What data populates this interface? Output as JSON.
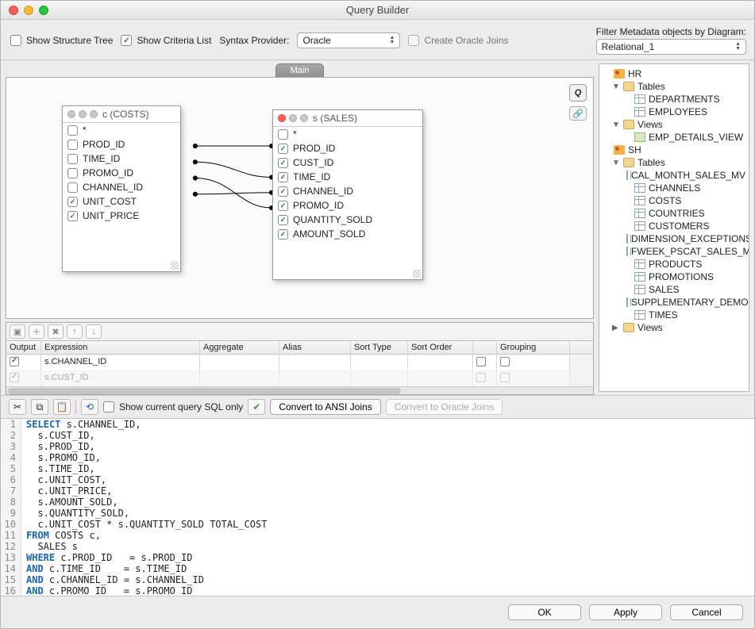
{
  "title": "Query Builder",
  "toolbar": {
    "show_structure_tree": {
      "label": "Show Structure Tree",
      "checked": false
    },
    "show_criteria_list": {
      "label": "Show Criteria List",
      "checked": true
    },
    "syntax_provider_label": "Syntax Provider:",
    "syntax_provider_value": "Oracle",
    "create_oracle_joins": {
      "label": "Create Oracle Joins",
      "checked": false
    },
    "filter_label": "Filter Metadata objects by Diagram:",
    "filter_value": "Relational_1"
  },
  "tabs": {
    "main": "Main"
  },
  "q_badge": "Q",
  "link_badge": "🔗",
  "nodes": {
    "c": {
      "title": "c (COSTS)",
      "fields": [
        {
          "name": "*",
          "checked": false
        },
        {
          "name": "PROD_ID",
          "checked": false
        },
        {
          "name": "TIME_ID",
          "checked": false
        },
        {
          "name": "PROMO_ID",
          "checked": false
        },
        {
          "name": "CHANNEL_ID",
          "checked": false
        },
        {
          "name": "UNIT_COST",
          "checked": true
        },
        {
          "name": "UNIT_PRICE",
          "checked": true
        }
      ]
    },
    "s": {
      "title": "s (SALES)",
      "fields": [
        {
          "name": "*",
          "checked": false
        },
        {
          "name": "PROD_ID",
          "checked": true
        },
        {
          "name": "CUST_ID",
          "checked": true
        },
        {
          "name": "TIME_ID",
          "checked": true
        },
        {
          "name": "CHANNEL_ID",
          "checked": true
        },
        {
          "name": "PROMO_ID",
          "checked": true
        },
        {
          "name": "QUANTITY_SOLD",
          "checked": true
        },
        {
          "name": "AMOUNT_SOLD",
          "checked": true
        }
      ]
    }
  },
  "criteria": {
    "headers": [
      "Output",
      "Expression",
      "Aggregate",
      "Alias",
      "Sort Type",
      "Sort Order",
      "",
      "Grouping"
    ],
    "rows": [
      {
        "output": true,
        "expression": "s.CHANNEL_ID",
        "group": false
      },
      {
        "output": true,
        "expression": "s.CUST_ID",
        "group": false
      }
    ]
  },
  "sql_toolbar": {
    "show_current_only": {
      "label": "Show current query SQL only",
      "checked": false
    },
    "btn_ansi": "Convert to ANSI Joins",
    "btn_oracle": "Convert to Oracle Joins"
  },
  "sql": {
    "lines": [
      {
        "n": 1,
        "kw": "SELECT",
        "rest": " s.CHANNEL_ID,"
      },
      {
        "n": 2,
        "kw": "",
        "rest": "  s.CUST_ID,"
      },
      {
        "n": 3,
        "kw": "",
        "rest": "  s.PROD_ID,"
      },
      {
        "n": 4,
        "kw": "",
        "rest": "  s.PROMO_ID,"
      },
      {
        "n": 5,
        "kw": "",
        "rest": "  s.TIME_ID,"
      },
      {
        "n": 6,
        "kw": "",
        "rest": "  c.UNIT_COST,"
      },
      {
        "n": 7,
        "kw": "",
        "rest": "  c.UNIT_PRICE,"
      },
      {
        "n": 8,
        "kw": "",
        "rest": "  s.AMOUNT_SOLD,"
      },
      {
        "n": 9,
        "kw": "",
        "rest": "  s.QUANTITY_SOLD,"
      },
      {
        "n": 10,
        "kw": "",
        "rest": "  c.UNIT_COST * s.QUANTITY_SOLD TOTAL_COST"
      },
      {
        "n": 11,
        "kw": "FROM",
        "rest": " COSTS c,"
      },
      {
        "n": 12,
        "kw": "",
        "rest": "  SALES s"
      },
      {
        "n": 13,
        "kw": "WHERE",
        "rest": " c.PROD_ID   = s.PROD_ID"
      },
      {
        "n": 14,
        "kw": "AND",
        "rest": " c.TIME_ID    = s.TIME_ID"
      },
      {
        "n": 15,
        "kw": "AND",
        "rest": " c.CHANNEL_ID = s.CHANNEL_ID"
      },
      {
        "n": 16,
        "kw": "AND",
        "rest": " c.PROMO_ID   = s.PROMO_ID"
      }
    ]
  },
  "tree": {
    "hr": {
      "label": "HR",
      "tables_label": "Tables",
      "tables": [
        "DEPARTMENTS",
        "EMPLOYEES"
      ],
      "views_label": "Views",
      "views": [
        "EMP_DETAILS_VIEW"
      ]
    },
    "sh": {
      "label": "SH",
      "tables_label": "Tables",
      "tables": [
        "CAL_MONTH_SALES_MV",
        "CHANNELS",
        "COSTS",
        "COUNTRIES",
        "CUSTOMERS",
        "DIMENSION_EXCEPTIONS",
        "FWEEK_PSCAT_SALES_MV",
        "PRODUCTS",
        "PROMOTIONS",
        "SALES",
        "SUPPLEMENTARY_DEMOGRAPHICS",
        "TIMES"
      ],
      "views_label": "Views"
    }
  },
  "footer": {
    "ok": "OK",
    "apply": "Apply",
    "cancel": "Cancel"
  }
}
